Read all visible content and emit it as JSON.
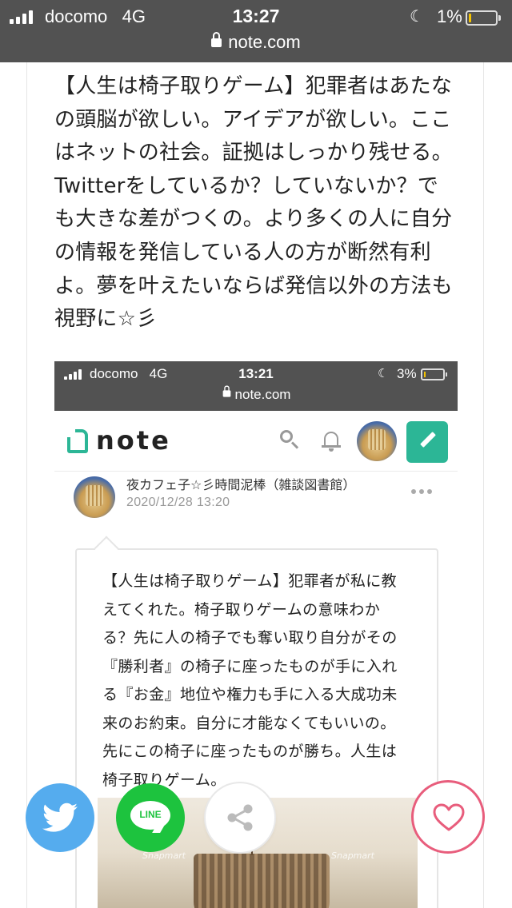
{
  "status_bar": {
    "carrier": "docomo",
    "network": "4G",
    "time": "13:27",
    "battery": "1%",
    "url": "note.com"
  },
  "article": {
    "lines": [
      "【人生は椅子取りゲーム】犯罪者はあたな",
      "の頭脳が欲しい。アイデアが欲しい。ここ",
      "はネットの社会。証拠はしっかり残せる。",
      "Twitterをしているか？していないか？で",
      "も大きな差がつくの。より多くの人に自分",
      "の情報を発信している人の方が断然有利",
      "よ。夢を叶えたいならば発信以外の方法も",
      "視野に☆彡"
    ]
  },
  "embedded": {
    "status_bar": {
      "carrier": "docomo",
      "network": "4G",
      "time": "13:21",
      "battery": "3%",
      "url": "note.com"
    },
    "header": {
      "logo": "note"
    },
    "post": {
      "author": "夜カフェ子☆彡時間泥棒（雑談図書館）",
      "date": "2020/12/28 13:20",
      "lines": [
        "【人生は椅子取りゲーム】犯罪者が私に教",
        "えてくれた。椅子取りゲームの意味わか",
        "る？先に人の椅子でも奪い取り自分がその",
        "『勝利者』の椅子に座ったものが手に入れ",
        "る『お金』地位や権力も手に入る大成功未",
        "来のお約束。自分に才能なくてもいいの。",
        "先にこの椅子に座ったものが勝ち。人生は",
        "椅子取りゲーム。"
      ],
      "photo_watermark": "Snapmart"
    }
  },
  "share": {
    "line_label": "LINE"
  },
  "colors": {
    "status_bg": "#525252",
    "note_green": "#2cb696",
    "twitter_blue": "#55acee",
    "line_green": "#1dc33e",
    "like_pink": "#e85d7c"
  }
}
